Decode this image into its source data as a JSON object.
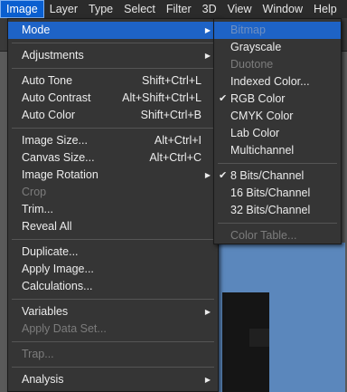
{
  "menubar": {
    "items": [
      "Image",
      "Layer",
      "Type",
      "Select",
      "Filter",
      "3D",
      "View",
      "Window",
      "Help"
    ]
  },
  "image_menu": {
    "mode": "Mode",
    "adjustments": "Adjustments",
    "auto_tone": "Auto Tone",
    "auto_tone_shortcut": "Shift+Ctrl+L",
    "auto_contrast": "Auto Contrast",
    "auto_contrast_shortcut": "Alt+Shift+Ctrl+L",
    "auto_color": "Auto Color",
    "auto_color_shortcut": "Shift+Ctrl+B",
    "image_size": "Image Size...",
    "image_size_shortcut": "Alt+Ctrl+I",
    "canvas_size": "Canvas Size...",
    "canvas_size_shortcut": "Alt+Ctrl+C",
    "image_rotation": "Image Rotation",
    "crop": "Crop",
    "trim": "Trim...",
    "reveal_all": "Reveal All",
    "duplicate": "Duplicate...",
    "apply_image": "Apply Image...",
    "calculations": "Calculations...",
    "variables": "Variables",
    "apply_data_set": "Apply Data Set...",
    "trap": "Trap...",
    "analysis": "Analysis"
  },
  "mode_submenu": {
    "bitmap": "Bitmap",
    "grayscale": "Grayscale",
    "duotone": "Duotone",
    "indexed_color": "Indexed Color...",
    "rgb_color": "RGB Color",
    "cmyk_color": "CMYK Color",
    "lab_color": "Lab Color",
    "multichannel": "Multichannel",
    "bits8": "8 Bits/Channel",
    "bits16": "16 Bits/Channel",
    "bits32": "32 Bits/Channel",
    "color_table": "Color Table..."
  },
  "icons": {
    "check": "checkmark-icon",
    "submenu": "triangle-right-icon"
  },
  "colors": {
    "highlight": "#1e63c6",
    "menu_bg": "#353535",
    "disabled_text": "#7c7c7c",
    "document": "#5b87bc"
  }
}
